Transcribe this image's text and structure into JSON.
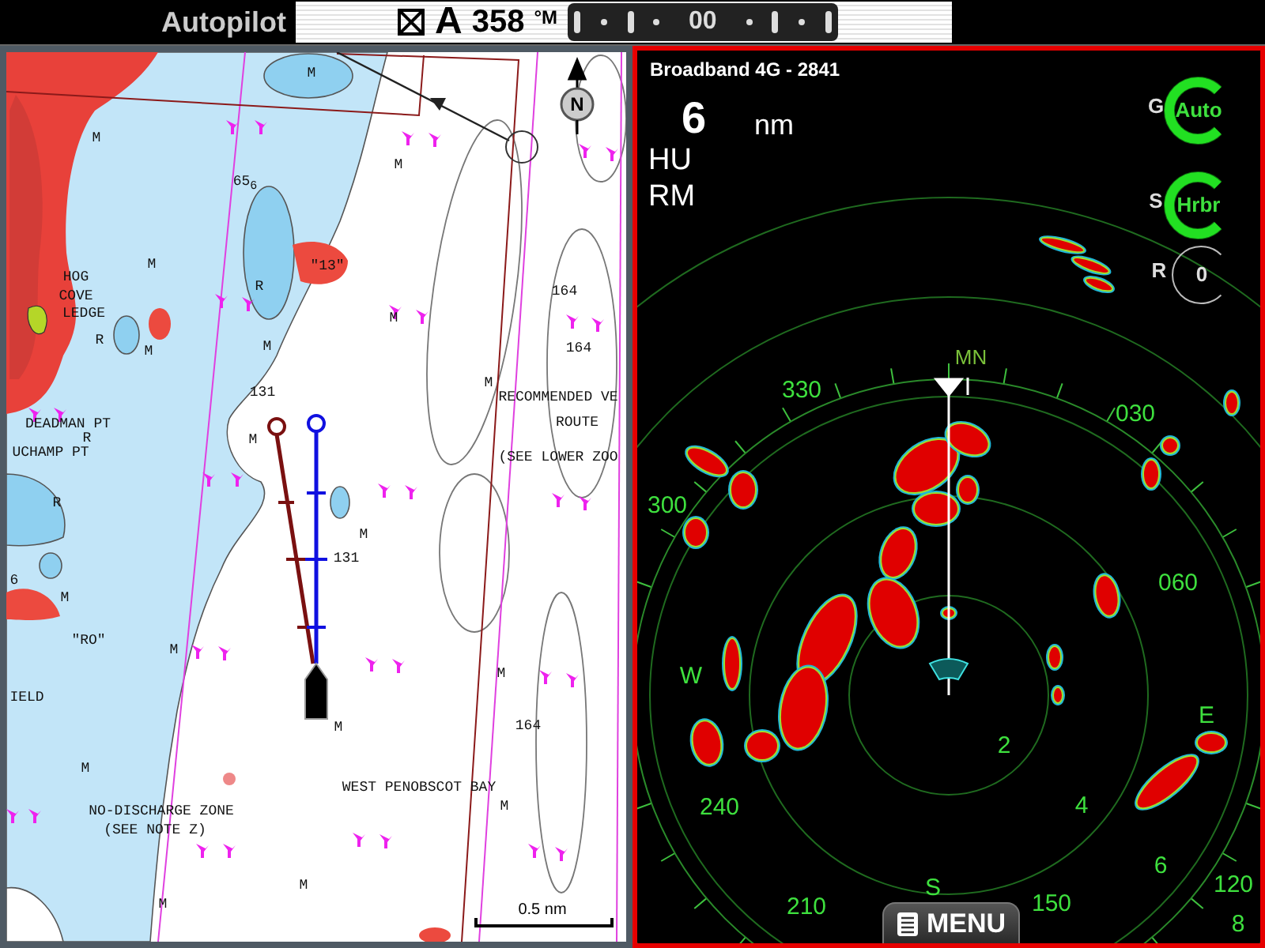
{
  "top_bar": {
    "title": "Autopilot",
    "mode": "A",
    "heading": "358",
    "heading_unit": "°M",
    "rudder": "00"
  },
  "chart": {
    "labels": [
      "M",
      "M",
      "M",
      "65$_{6}$",
      "HOG",
      "M",
      "\"13\"",
      "COVE",
      "R",
      "164",
      "LEDGE",
      "M",
      "R",
      "M",
      "M",
      "164",
      "M",
      "131",
      "RECOMMENDED VE",
      "DEADMAN PT",
      "ROUTE",
      "R",
      "M",
      "UCHAMP PT",
      "(SEE LOWER ZOO",
      "R",
      "M",
      "131",
      "6",
      "M",
      "\"RO\"",
      "M",
      "M",
      "IELD",
      "M",
      "164",
      "M",
      "WEST PENOBSCOT BAY",
      "NO-DISCHARGE ZONE",
      "M",
      "(SEE NOTE Z)",
      "M",
      "M"
    ],
    "north": "N",
    "scale": "0.5 nm"
  },
  "radar": {
    "source": "Broadband 4G - 2841",
    "range": "6",
    "range_unit": "nm",
    "orientation": "HU",
    "motion": "RM",
    "controls": [
      {
        "letter": "G",
        "value": "Auto",
        "active": true
      },
      {
        "letter": "S",
        "value": "Hrbr",
        "active": true
      },
      {
        "letter": "R",
        "value": "0",
        "active": false
      }
    ],
    "north_marker": "MN",
    "bearing_labels": [
      "330",
      "030",
      "300",
      "060",
      "W",
      "E",
      "240",
      "120",
      "210",
      "S",
      "150"
    ],
    "range_labels": [
      "2",
      "4",
      "6",
      "8"
    ],
    "menu": "MENU"
  }
}
